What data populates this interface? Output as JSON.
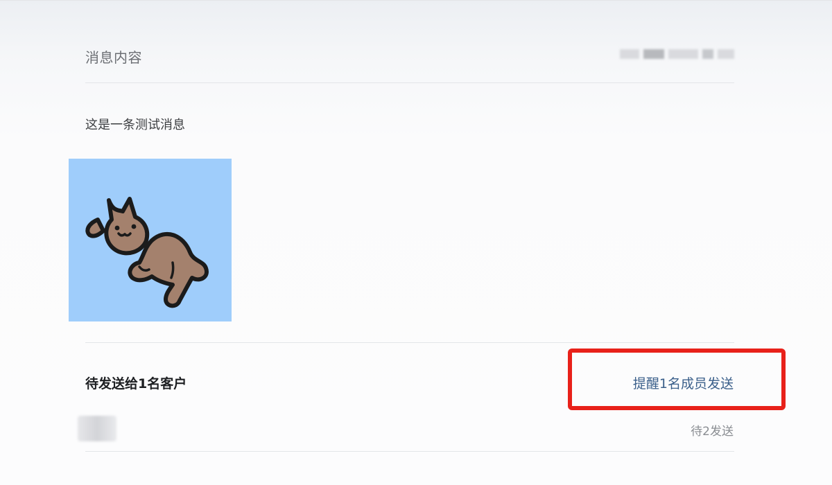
{
  "header": {
    "title": "消息内容"
  },
  "message": {
    "text": "这是一条测试消息"
  },
  "pending": {
    "title": "待发送给1名客户",
    "remind_link": "提醒1名成员发送",
    "status": "待2发送"
  },
  "colors": {
    "highlight": "#e8211a",
    "link": "#3a5f8a",
    "image_background": "#9fcdfb"
  }
}
